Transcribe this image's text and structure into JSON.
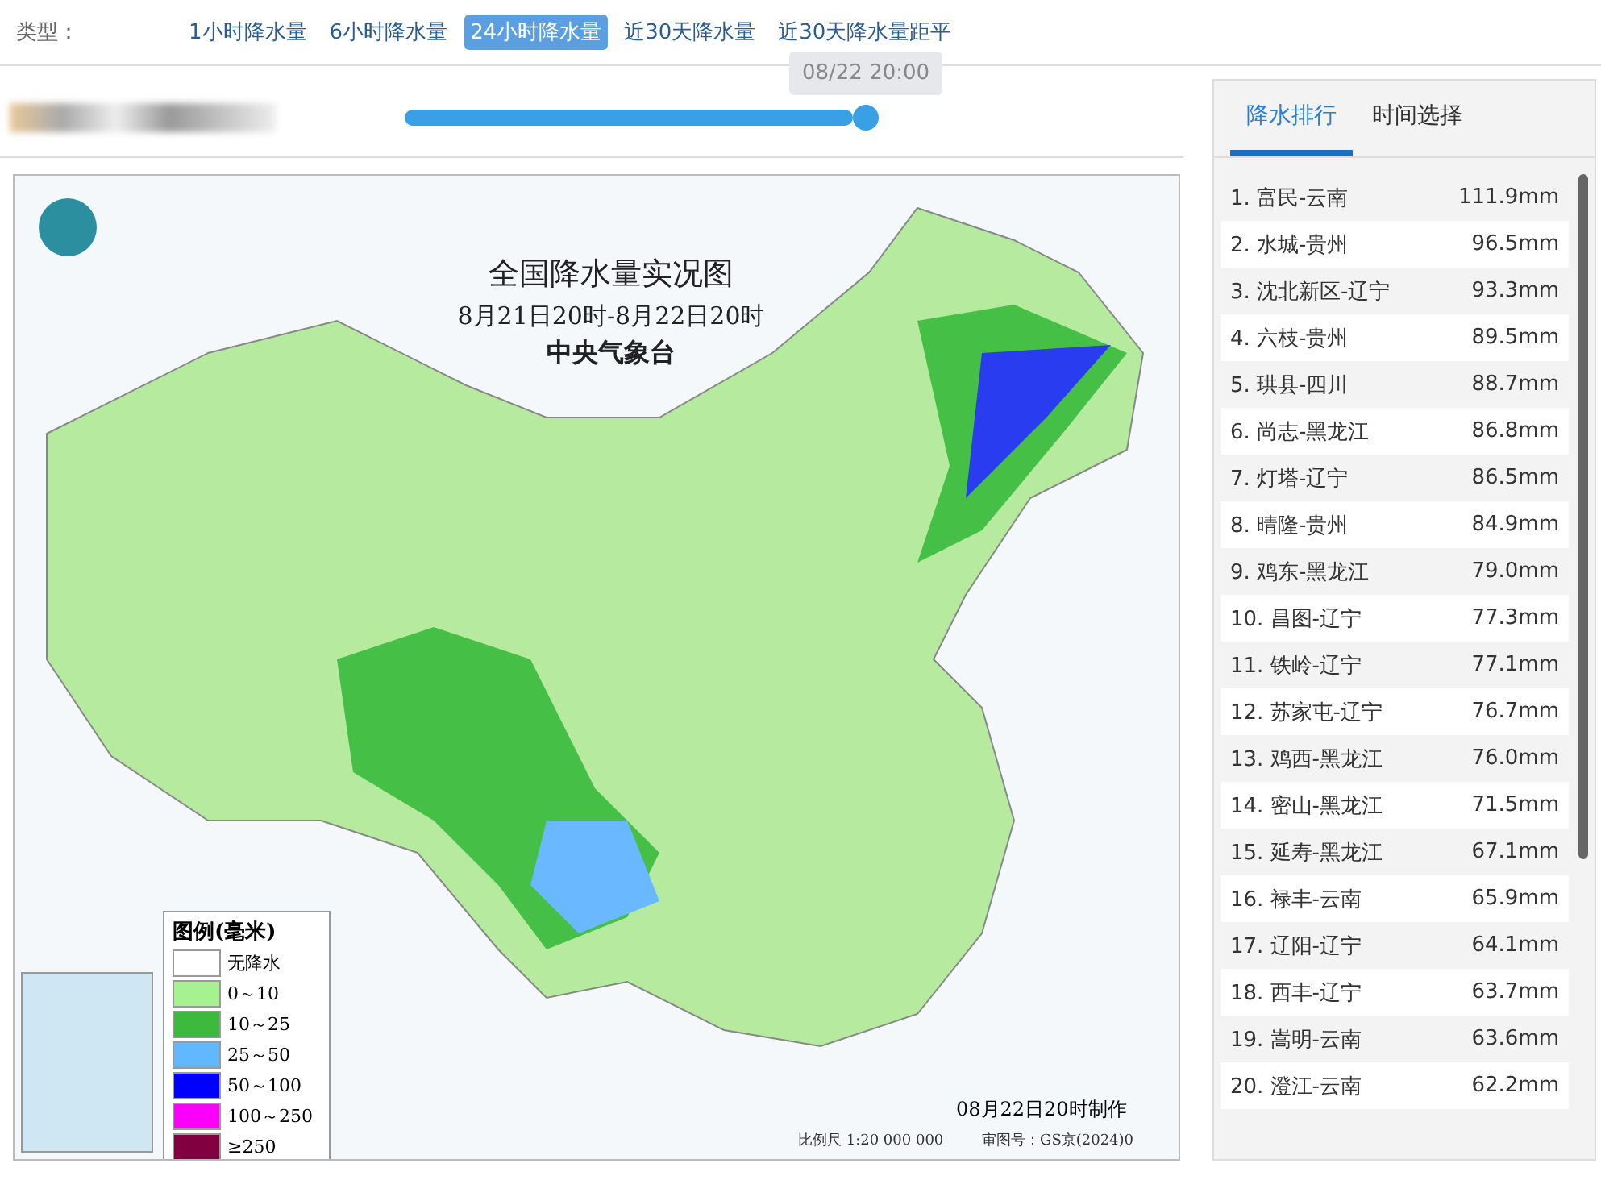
{
  "type_filter": {
    "label": "类型：",
    "options": [
      {
        "label": "1小时降水量",
        "selected": false
      },
      {
        "label": "6小时降水量",
        "selected": false
      },
      {
        "label": "24小时降水量",
        "selected": true
      },
      {
        "label": "近30天降水量",
        "selected": false
      },
      {
        "label": "近30天降水量距平",
        "selected": false
      }
    ]
  },
  "time_slider": {
    "level": 1,
    "tooltip": "08/22 20:00"
  },
  "map": {
    "title": "全国降水量实况图",
    "period": "8月21日20时-8月22日20时",
    "publisher": "中央气象台",
    "legend": {
      "title": "图例(毫米)",
      "items": [
        {
          "label": "无降水",
          "color": "#ffffff"
        },
        {
          "label": "0～10",
          "color": "#a6f28f"
        },
        {
          "label": "10～25",
          "color": "#3dba3d"
        },
        {
          "label": "25～50",
          "color": "#61b8ff"
        },
        {
          "label": "50～100",
          "color": "#0000ff"
        },
        {
          "label": "100～250",
          "color": "#fa00fa"
        },
        {
          "label": "≥250",
          "color": "#800040"
        }
      ]
    },
    "made_time": "08月22日20时制作",
    "scale": "比例尺 1:20 000 000",
    "approval": "审图号：GS京(2024)0"
  },
  "side_panel": {
    "tabs": [
      {
        "label": "降水排行",
        "selected": true
      },
      {
        "label": "时间选择",
        "selected": false
      }
    ],
    "ranking": [
      {
        "station": "1. 富民-云南",
        "amount": "111.9mm"
      },
      {
        "station": "2. 水城-贵州",
        "amount": "96.5mm"
      },
      {
        "station": "3. 沈北新区-辽宁",
        "amount": "93.3mm"
      },
      {
        "station": "4. 六枝-贵州",
        "amount": "89.5mm"
      },
      {
        "station": "5. 珙县-四川",
        "amount": "88.7mm"
      },
      {
        "station": "6. 尚志-黑龙江",
        "amount": "86.8mm"
      },
      {
        "station": "7. 灯塔-辽宁",
        "amount": "86.5mm"
      },
      {
        "station": "8. 晴隆-贵州",
        "amount": "84.9mm"
      },
      {
        "station": "9. 鸡东-黑龙江",
        "amount": "79.0mm"
      },
      {
        "station": "10. 昌图-辽宁",
        "amount": "77.3mm"
      },
      {
        "station": "11. 铁岭-辽宁",
        "amount": "77.1mm"
      },
      {
        "station": "12. 苏家屯-辽宁",
        "amount": "76.7mm"
      },
      {
        "station": "13. 鸡西-黑龙江",
        "amount": "76.0mm"
      },
      {
        "station": "14. 密山-黑龙江",
        "amount": "71.5mm"
      },
      {
        "station": "15. 延寿-黑龙江",
        "amount": "67.1mm"
      },
      {
        "station": "16. 禄丰-云南",
        "amount": "65.9mm"
      },
      {
        "station": "17. 辽阳-辽宁",
        "amount": "64.1mm"
      },
      {
        "station": "18. 西丰-辽宁",
        "amount": "63.7mm"
      },
      {
        "station": "19. 嵩明-云南",
        "amount": "63.6mm"
      },
      {
        "station": "20. 澄江-云南",
        "amount": "62.2mm"
      }
    ]
  }
}
